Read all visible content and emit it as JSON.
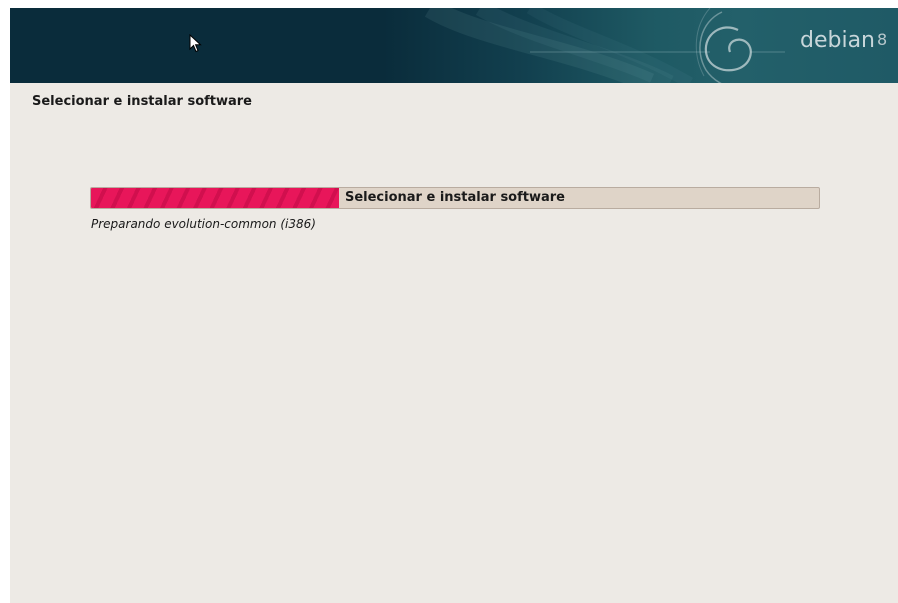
{
  "banner": {
    "logo_text": "debian",
    "logo_version": "8",
    "logo_icon": "debian-swirl-icon"
  },
  "cursor_icon": "mouse-pointer-icon",
  "page": {
    "title": "Selecionar e instalar software"
  },
  "progress": {
    "label": "Selecionar e instalar software",
    "value_percent": 34,
    "status": "Preparando evolution-common (i386)"
  },
  "colors": {
    "banner_dark": "#0a2c3b",
    "banner_teal": "#23606a",
    "background": "#edeae5",
    "progress_fill": "#e8165a",
    "progress_track": "#dfd4c8"
  }
}
